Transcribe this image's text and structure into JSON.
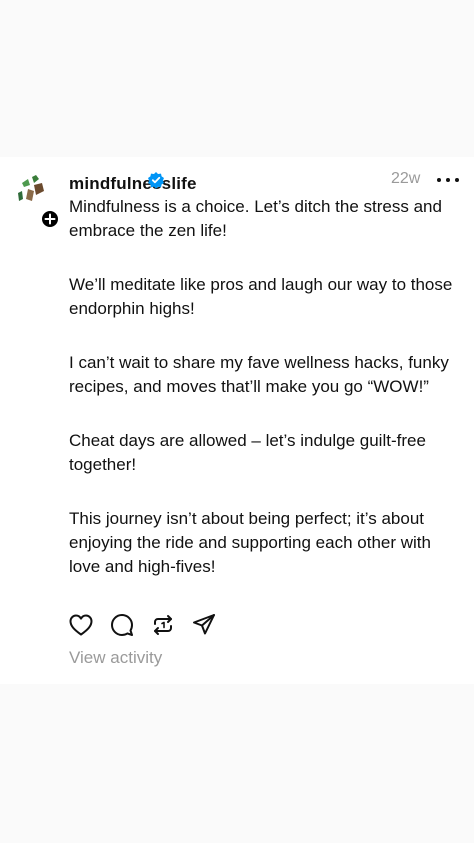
{
  "post": {
    "username": "mindfulnesslife",
    "timestamp": "22w",
    "paragraphs": [
      "Mindfulness is a choice. Let’s ditch the stress and embrace the zen life!",
      "We’ll meditate like pros and laugh our way to those endorphin highs!",
      "I can’t wait to share my fave wellness hacks, funky recipes, and moves that’ll make you go “WOW!”",
      " Cheat days are allowed – let’s indulge guilt-free together!",
      "This journey isn’t about being perfect; it’s about enjoying the ride and supporting each other with love and high-fives!"
    ],
    "view_activity": "View activity"
  },
  "icons": {
    "verified": "verified-badge-icon",
    "more": "more-options-icon",
    "like": "heart-icon",
    "comment": "comment-bubble-icon",
    "repost": "repost-icon",
    "share": "share-send-icon",
    "follow": "plus-icon"
  },
  "colors": {
    "verified": "#0095f6",
    "muted_text": "#9a9a9a",
    "text": "#111111"
  }
}
